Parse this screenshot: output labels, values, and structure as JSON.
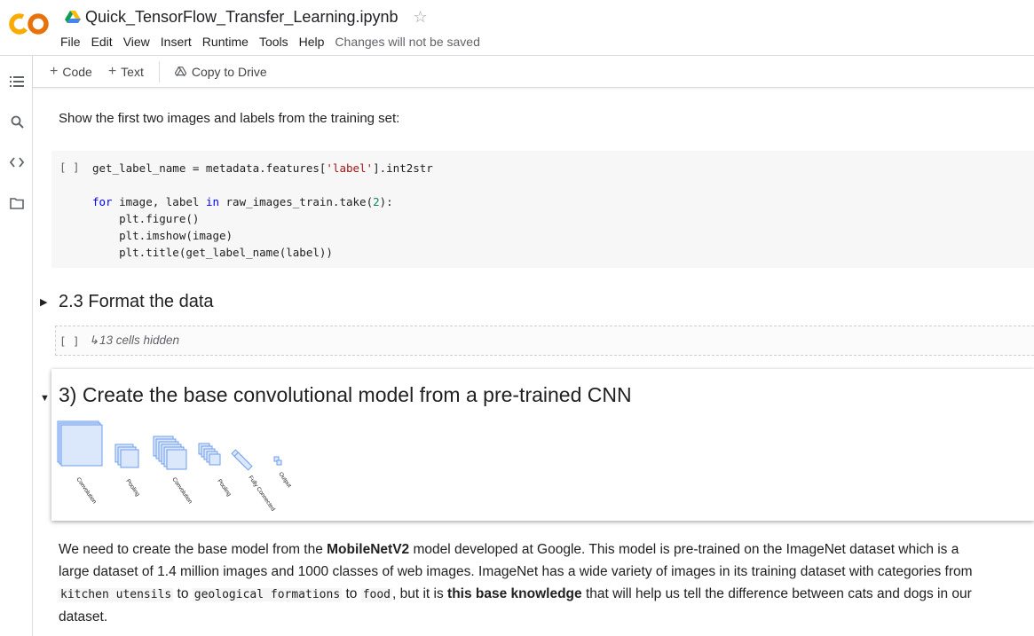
{
  "header": {
    "title": "Quick_TensorFlow_Transfer_Learning.ipynb",
    "menu": [
      "File",
      "Edit",
      "View",
      "Insert",
      "Runtime",
      "Tools",
      "Help"
    ],
    "status": "Changes will not be saved"
  },
  "toolbar": {
    "code_label": "Code",
    "text_label": "Text",
    "copy_label": "Copy to Drive"
  },
  "rail": {
    "icons": [
      "toc-icon",
      "search-icon",
      "code-snippets-icon",
      "folder-icon"
    ]
  },
  "cells": {
    "intro_text": "Show the first two images and labels from the training set:",
    "run_bracket": "[ ]",
    "section_2_3": "2.3 Format the data",
    "hidden_cells": "13 cells hidden",
    "section_3": "3) Create the base convolutional model from a pre-trained CNN",
    "cnn_labels": [
      "Convolution",
      "Pooling",
      "Convolution",
      "Pooling",
      "Fully Connected",
      "Output"
    ]
  },
  "paragraph": {
    "t1": "We need to create the base model from the ",
    "b1": "MobileNetV2",
    "t2": " model developed at Google. This model is pre-trained on the ImageNet dataset which is a large dataset of 1.4 million images and 1000 classes of web images. ImageNet has a wide variety of images in its training dataset with categories from ",
    "c1": "kitchen utensils",
    "t3": " to ",
    "c2": "geological formations",
    "t4": " to ",
    "c3": "food",
    "t5": ", but it is ",
    "b2": "this base knowledge",
    "t6": " that will help us tell the difference between cats and dogs in our dataset."
  },
  "colors": {
    "colab_orange": "#f9ab00",
    "keyword": "#0000ff",
    "string": "#a31515",
    "number": "#09885a"
  }
}
